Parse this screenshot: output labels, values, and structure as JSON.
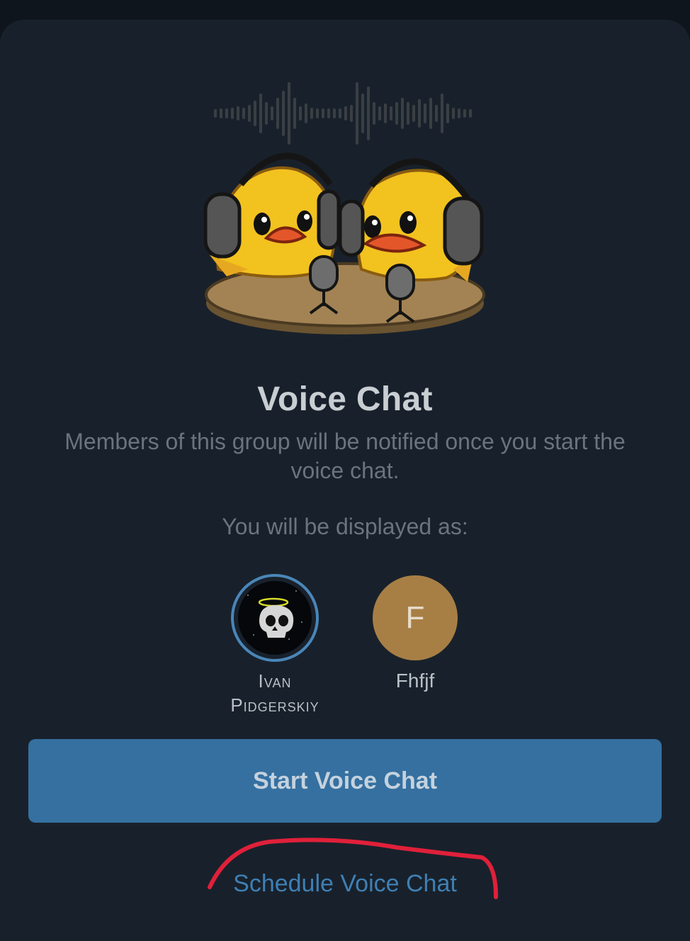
{
  "dialog": {
    "title": "Voice Chat",
    "subtitle": "Members of this group will be notified once you start the voice chat.",
    "displayed_as_label": "You will be displayed as:"
  },
  "peers": [
    {
      "name": "Ivan Pidgerskiy",
      "avatar": "skull-with-halo-image",
      "selected": true
    },
    {
      "name": "Fhfjf",
      "initial": "F",
      "avatar_color": "#a77f45",
      "selected": false
    }
  ],
  "actions": {
    "start_label": "Start Voice Chat",
    "schedule_label": "Schedule Voice Chat"
  },
  "colors": {
    "sheet_background": "#18212b",
    "primary_button": "#3570a0",
    "link": "#3f7fb4",
    "annotation_stroke": "#e0203a"
  },
  "illustration": "two-ducks-with-headphones-and-microphones",
  "annotation": "red-hand-drawn-underline-around-schedule-link"
}
